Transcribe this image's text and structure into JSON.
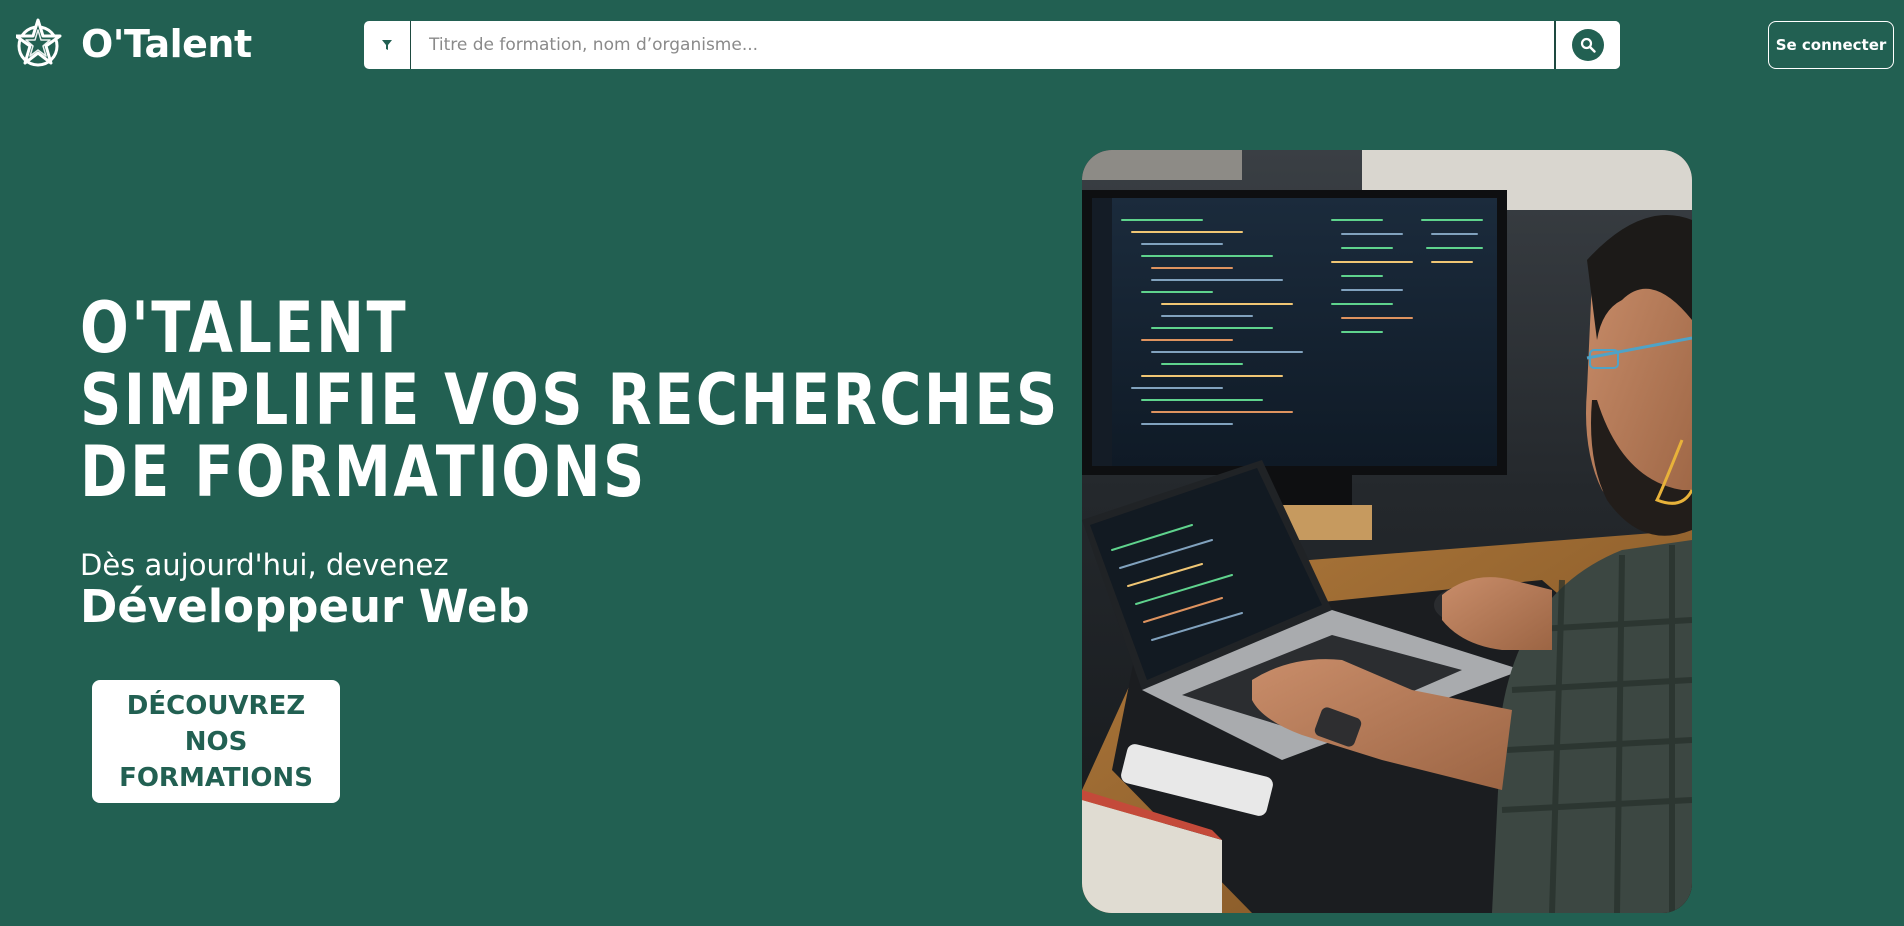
{
  "brand": {
    "name": "O'Talent",
    "logo_icon": "star-logo-icon"
  },
  "search": {
    "filter_icon": "filter-icon",
    "placeholder": "Titre de formation, nom d’organisme...",
    "value": "",
    "submit_icon": "search-icon"
  },
  "header": {
    "login_label": "Se connecter"
  },
  "hero": {
    "title_lines": [
      "O'TALENT",
      "SIMPLIFIE VOS RECHERCHES",
      "DE FORMATIONS"
    ],
    "subtitle": "Dès aujourd'hui, devenez",
    "role": "Développeur Web",
    "cta_lines": [
      "DÉCOUVREZ",
      "NOS",
      "FORMATIONS"
    ]
  },
  "photo": {
    "subject": "developer-at-computer-photo"
  },
  "colors": {
    "background": "#226052",
    "text": "#ffffff",
    "accent": "#226052"
  }
}
